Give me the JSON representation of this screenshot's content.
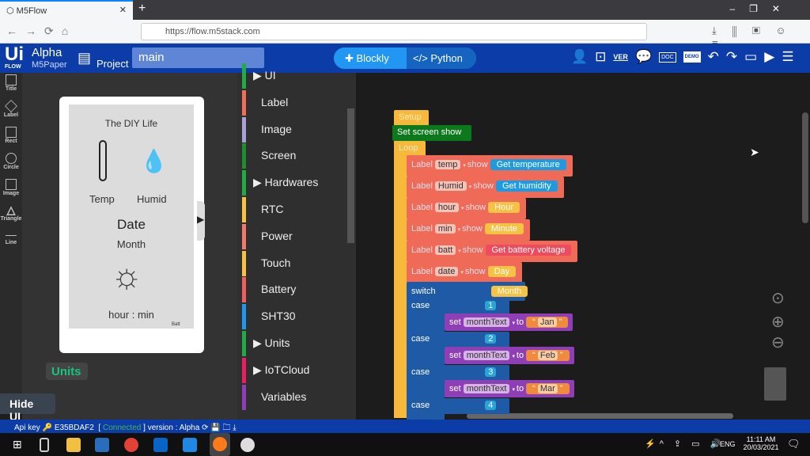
{
  "browser": {
    "tab_title": "M5Flow",
    "url": "https://flow.m5stack.com"
  },
  "app": {
    "logo": "UiFlow",
    "edition": "Alpha",
    "device": "M5Paper",
    "project_label": "Project",
    "project_name": "main",
    "modes": [
      "Blockly",
      "Python"
    ],
    "toolbar_icons": [
      "user-icon",
      "new-file-icon",
      "version-icon",
      "chat-icon",
      "doc-icon",
      "demo-icon",
      "undo-icon",
      "redo-icon",
      "device-icon",
      "run-icon",
      "menu-icon"
    ],
    "ver_label": "VER",
    "doc_label": "DOC",
    "demo_label": "DEMO"
  },
  "tools": [
    "Title",
    "Label",
    "Rect",
    "Circle",
    "Image",
    "Triangle",
    "Line"
  ],
  "screen": {
    "title": "The DIY Life",
    "temp": "Temp",
    "humid": "Humid",
    "date": "Date",
    "month": "Month",
    "time": "hour : min",
    "batt": "Batt"
  },
  "units_button": "Units",
  "hide_ui": "Hide UI",
  "palette": {
    "items": [
      {
        "label": "UI",
        "color": "#22aa44",
        "type": "group"
      },
      {
        "label": "Label",
        "color": "#ef6f5a"
      },
      {
        "label": "Image",
        "color": "#a9a0d8"
      },
      {
        "label": "Screen",
        "color": "#1e8e2e"
      },
      {
        "label": "Hardwares",
        "color": "#22aa44",
        "type": "group"
      },
      {
        "label": "RTC",
        "color": "#f6c244"
      },
      {
        "label": "Power",
        "color": "#ef7a6e"
      },
      {
        "label": "Touch",
        "color": "#f6c244"
      },
      {
        "label": "Battery",
        "color": "#ee5f5f"
      },
      {
        "label": "SHT30",
        "color": "#2196f3"
      },
      {
        "label": "Units",
        "color": "#22aa44",
        "type": "group"
      },
      {
        "label": "IoTCloud",
        "color": "#e91e63",
        "type": "group"
      },
      {
        "label": "Variables",
        "color": "#8e3fb5"
      }
    ]
  },
  "blocks": {
    "setup": "Setup",
    "set_screen": "Set screen show",
    "loop": "Loop",
    "labels": [
      {
        "kw": "Label",
        "name": "temp",
        "show": "show",
        "value": "Get temperature",
        "color": "#1e9be0"
      },
      {
        "kw": "Label",
        "name": "Humid",
        "show": "show",
        "value": "Get humidity",
        "color": "#1e9be0"
      },
      {
        "kw": "Label",
        "name": "hour",
        "show": "show",
        "value": "Hour",
        "color": "#f6c244"
      },
      {
        "kw": "Label",
        "name": "min",
        "show": "show",
        "value": "Minute",
        "color": "#f6c244"
      },
      {
        "kw": "Label",
        "name": "batt",
        "show": "show",
        "value": "Get battery voltage",
        "color": "#ee4b5f"
      },
      {
        "kw": "Label",
        "name": "date",
        "show": "show",
        "value": "Day",
        "color": "#f6c244"
      }
    ],
    "switch": "switch",
    "switch_value": "Month",
    "cases": [
      {
        "kw": "case",
        "num": "1",
        "set": "set",
        "var": "monthText",
        "to": "to",
        "text": "Jan"
      },
      {
        "kw": "case",
        "num": "2",
        "set": "set",
        "var": "monthText",
        "to": "to",
        "text": "Feb"
      },
      {
        "kw": "case",
        "num": "3",
        "set": "set",
        "var": "monthText",
        "to": "to",
        "text": "Mar"
      },
      {
        "kw": "case",
        "num": "4"
      }
    ]
  },
  "status": {
    "api_key_label": "Api key",
    "api_key": "E35BDAF2",
    "connection": "Connected",
    "version": "version : Alpha"
  },
  "taskbar": {
    "lang": "ENG",
    "time": "11:11 AM",
    "date": "20/03/2021"
  }
}
